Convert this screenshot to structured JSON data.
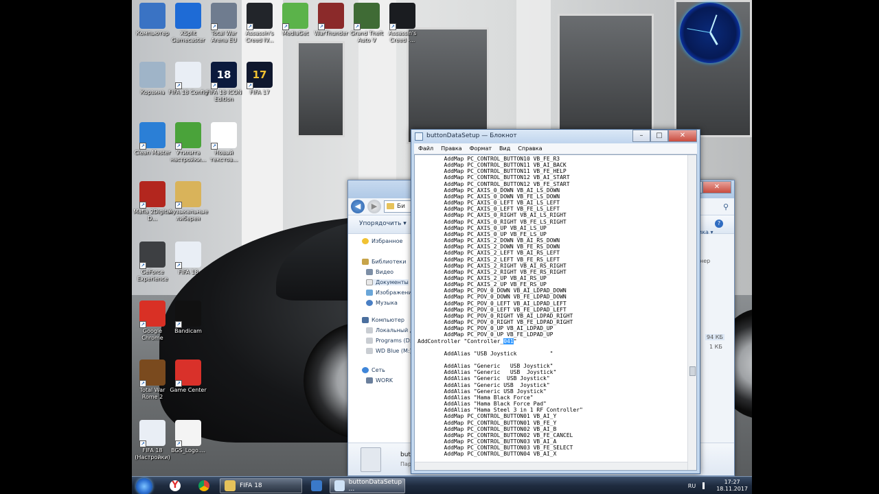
{
  "desktop": {
    "icons": [
      {
        "label": "Компьютер",
        "color": "#3a73c4"
      },
      {
        "label": "XSplit Gamecaster",
        "color": "#1e6bd6"
      },
      {
        "label": "Total War Arena EU",
        "color": "#6f7c8f"
      },
      {
        "label": "Assassin's Creed IV...",
        "color": "#22252a"
      },
      {
        "label": "MediaGet",
        "color": "#5bb34a"
      },
      {
        "label": "WarThunder",
        "color": "#8b2a2a"
      },
      {
        "label": "Grand Theft Auto V",
        "color": "#3f6b35"
      },
      {
        "label": "Assassin's Creed -...",
        "color": "#1a1c20"
      },
      {
        "label": "Корзина",
        "color": "#9fb4c8"
      },
      {
        "label": "FIFA 18 Config",
        "color": "#e9eef5"
      },
      {
        "label": "FIFA 18 ICON Edition",
        "color": "#0b1a3d",
        "text": "18"
      },
      {
        "label": "FIFA 17",
        "color": "#10182e",
        "text": "17"
      },
      {
        "label": "Clean Master",
        "color": "#2b7fd6"
      },
      {
        "label": "Утилита настройки...",
        "color": "#4aa33a"
      },
      {
        "label": "Новый текстов...",
        "color": "#ffffff"
      },
      {
        "label": "Mafia 2Digital D...",
        "color": "#b3261e"
      },
      {
        "label": "музыкальные либерея",
        "color": "#d9b35a"
      },
      {
        "label": "GeForce Experience",
        "color": "#3d3f42"
      },
      {
        "label": "FIFA 18",
        "color": "#e9eef5"
      },
      {
        "label": "Google Chrome",
        "color": "#d93025"
      },
      {
        "label": "Bandicam",
        "color": "#111111"
      },
      {
        "label": "Total War Rome 2",
        "color": "#7a4a1e"
      },
      {
        "label": "Game Center",
        "color": "#d9312a"
      },
      {
        "label": "FIFA 18 (Настройки)",
        "color": "#e9eef5"
      },
      {
        "label": "BGS_Logo....",
        "color": "#f4f4f4"
      }
    ]
  },
  "explorer": {
    "address_crumb": "Би",
    "organize_label": "Упорядочить ▾",
    "nav": {
      "favorites": "Избранное",
      "libraries": "Библиотеки",
      "video": "Видео",
      "documents": "Документы",
      "images": "Изображени",
      "music": "Музыка",
      "computer": "Компьютер",
      "local_disk": "Локальный д",
      "programs": "Programs (D:)",
      "wd_blue": "WD Blue (M:)",
      "network": "Сеть",
      "work": "WORK"
    },
    "details": {
      "name": "butto",
      "sub": "Пар"
    },
    "right": {
      "size1": "94 КБ",
      "size2": "1 КБ",
      "col": "ика ▾",
      "col2": "нер"
    }
  },
  "notepad": {
    "title": "buttonDataSetup — Блокнот",
    "menu": [
      "Файл",
      "Правка",
      "Формат",
      "Вид",
      "Справка"
    ],
    "lines": [
      "        AddMap PC_CONTROL_BUTTON10 VB_FE_R3",
      "        AddMap PC_CONTROL_BUTTON11 VB_AI_BACK",
      "        AddMap PC_CONTROL_BUTTON11 VB_FE_HELP",
      "        AddMap PC_CONTROL_BUTTON12 VB_AI_START",
      "        AddMap PC_CONTROL_BUTTON12 VB_FE_START",
      "        AddMap PC_AXIS_0_DOWN VB_AI_LS_DOWN",
      "        AddMap PC_AXIS_0_DOWN VB_FE_LS_DOWN",
      "        AddMap PC_AXIS_0_LEFT VB_AI_LS_LEFT",
      "        AddMap PC_AXIS_0_LEFT VB_FE_LS_LEFT",
      "        AddMap PC_AXIS_0_RIGHT VB_AI_LS_RIGHT",
      "        AddMap PC_AXIS_0_RIGHT VB_FE_LS_RIGHT",
      "        AddMap PC_AXIS_0_UP VB_AI_LS_UP",
      "        AddMap PC_AXIS_0_UP VB_FE_LS_UP",
      "        AddMap PC_AXIS_2_DOWN VB_AI_RS_DOWN",
      "        AddMap PC_AXIS_2_DOWN VB_FE_RS_DOWN",
      "        AddMap PC_AXIS_2_LEFT VB_AI_RS_LEFT",
      "        AddMap PC_AXIS_2_LEFT VB_FE_RS_LEFT",
      "        AddMap PC_AXIS_2_RIGHT VB_AI_RS_RIGHT",
      "        AddMap PC_AXIS_2_RIGHT VB_FE_RS_RIGHT",
      "        AddMap PC_AXIS_2_UP VB_AI_RS_UP",
      "        AddMap PC_AXIS_2_UP VB_FE_RS_UP",
      "        AddMap PC_POV_0_DOWN VB_AI_LDPAD_DOWN",
      "        AddMap PC_POV_0_DOWN VB_FE_LDPAD_DOWN",
      "        AddMap PC_POV_0_LEFT VB_AI_LDPAD_LEFT",
      "        AddMap PC_POV_0_LEFT VB_FE_LDPAD_LEFT",
      "        AddMap PC_POV_0_RIGHT VB_AI_LDPAD_RIGHT",
      "        AddMap PC_POV_0_RIGHT VB_FE_LDPAD_RIGHT",
      "        AddMap PC_POV_0_UP VB_AI_LDPAD_UP",
      "        AddMap PC_POV_0_UP VB_FE_LDPAD_UP",
      "AddController \"Controller_",
      "",
      "        AddAlias \"USB Joystick          \"",
      "",
      "        AddAlias \"Generic   USB Joystick\"",
      "        AddAlias \"Generic   USB  Joystick\"",
      "        AddAlias \"Generic  USB Joystick\"",
      "        AddAlias \"Generic USB  Joystick\"",
      "        AddAlias \"Generic USB Joystick\"",
      "        AddAlias \"Hama Black Force\"",
      "        AddAlias \"Hama Black Force Pad\"",
      "        AddAlias \"Hama Steel 3 in 1 RF Controller\"",
      "        AddMap PC_CONTROL_BUTTON01 VB_AI_Y",
      "        AddMap PC_CONTROL_BUTTON01 VB_FE_Y",
      "        AddMap PC_CONTROL_BUTTON02 VB_AI_B",
      "        AddMap PC_CONTROL_BUTTON02 VB_FE_CANCEL",
      "        AddMap PC_CONTROL_BUTTON03 VB_AI_A",
      "        AddMap PC_CONTROL_BUTTON03 VB_FE_SELECT",
      "        AddMap PC_CONTROL_BUTTON04 VB_AI_X"
    ],
    "selected_text": "041",
    "after_selection": "\""
  },
  "taskbar": {
    "tasks": [
      "FIFA 18",
      "buttonDataSetup ..."
    ],
    "lang": "RU",
    "time": "17:27",
    "date": "18.11.2017"
  }
}
